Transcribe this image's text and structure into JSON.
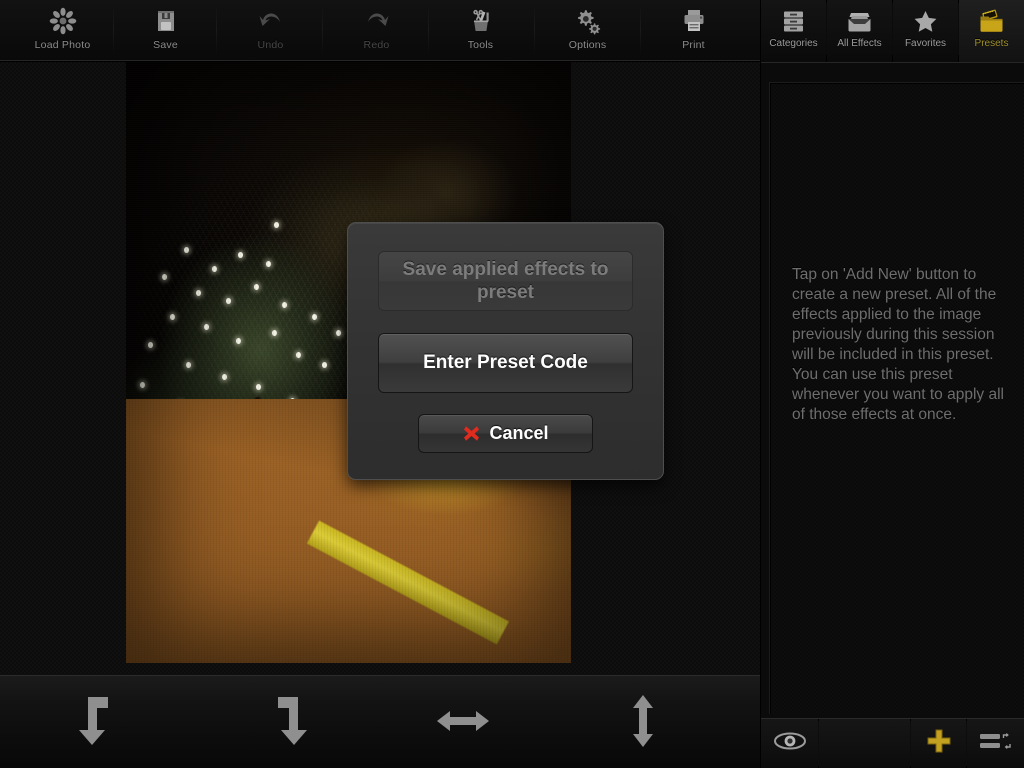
{
  "app": {
    "accent_gold": "#a09128",
    "cancel_x_color": "#e02b1f",
    "panel_text_color": "#6e6e6e"
  },
  "top_toolbar": {
    "items": [
      {
        "label": "Load Photo",
        "icon": "flower-aperture-icon",
        "disabled": false
      },
      {
        "label": "Save",
        "icon": "floppy-disk-icon",
        "disabled": false
      },
      {
        "label": "Undo",
        "icon": "undo-arrow-icon",
        "disabled": true
      },
      {
        "label": "Redo",
        "icon": "redo-arrow-icon",
        "disabled": true
      },
      {
        "label": "Tools",
        "icon": "tools-cup-icon",
        "disabled": false
      },
      {
        "label": "Options",
        "icon": "gears-icon",
        "disabled": false
      },
      {
        "label": "Print",
        "icon": "printer-icon",
        "disabled": false
      }
    ]
  },
  "bottom_toolbar": {
    "items": [
      {
        "name": "rotate-left",
        "icon": "rotate-left-icon"
      },
      {
        "name": "rotate-right",
        "icon": "rotate-right-icon"
      },
      {
        "name": "flip-horizontal",
        "icon": "flip-horizontal-icon"
      },
      {
        "name": "flip-vertical",
        "icon": "flip-vertical-icon"
      }
    ]
  },
  "right_panel": {
    "tabs": [
      {
        "label": "Categories",
        "icon": "drawers-icon",
        "active": false
      },
      {
        "label": "All Effects",
        "icon": "file-box-icon",
        "active": false
      },
      {
        "label": "Favorites",
        "icon": "star-icon",
        "active": false
      },
      {
        "label": "Presets",
        "icon": "film-folder-icon",
        "active": true
      }
    ],
    "hint_text": "Tap on 'Add New' button to create a new preset. All of the effects applied to the image previously during this session will be included in this preset. You can use this preset whenever you want to apply all of those effects at once.",
    "bottom_bar": [
      {
        "name": "preview-toggle",
        "icon": "eye-icon"
      },
      {
        "name": "empty-slot",
        "icon": "none"
      },
      {
        "name": "add-new",
        "icon": "plus-icon"
      },
      {
        "name": "reorder-list",
        "icon": "reorder-list-icon"
      }
    ]
  },
  "dialog": {
    "save_preset_label": "Save applied effects to preset",
    "enter_code_label": "Enter Preset Code",
    "cancel_label": "Cancel"
  },
  "photo": {
    "description": "Night photo of a lit Christmas tree with an orange tarp and yellow reflective stripe"
  }
}
